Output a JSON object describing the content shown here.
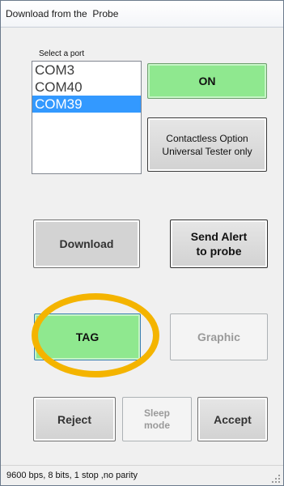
{
  "window": {
    "title": "Download from the  Probe"
  },
  "ports": {
    "label": "Select a port",
    "items": [
      "COM3",
      "COM40",
      "COM39"
    ],
    "selected": "COM39"
  },
  "buttons": {
    "on": "ON",
    "contactless": "Contactless Option\nUniversal Tester only",
    "download": "Download",
    "send_alert": "Send Alert\nto probe",
    "tag": "TAG",
    "graphic": "Graphic",
    "reject": "Reject",
    "sleep": "Sleep\nmode",
    "accept": "Accept"
  },
  "status": {
    "text": "9600 bps, 8 bits, 1 stop ,no parity"
  },
  "colors": {
    "active_green": "#8fe88f",
    "selection_blue": "#3399ff",
    "highlight_ring": "#f4b400"
  }
}
